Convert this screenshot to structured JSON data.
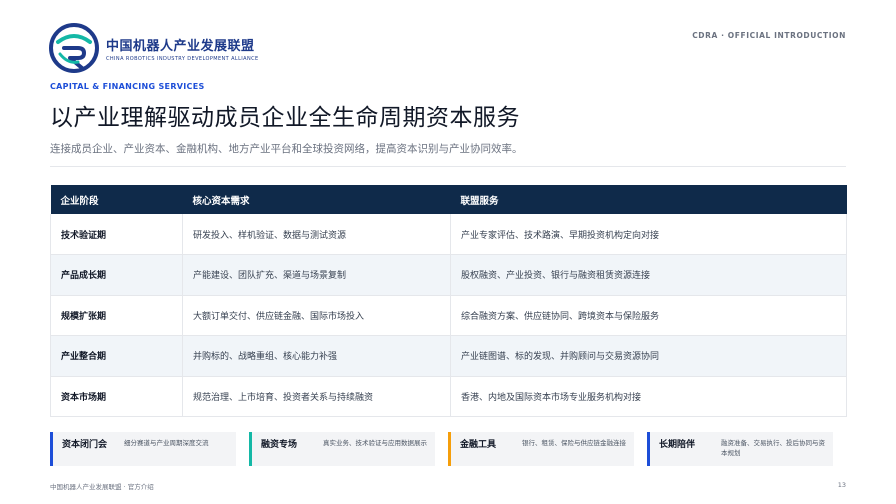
{
  "logo": {
    "name_cn": "中国机器人产业发展联盟",
    "name_en": "CHINA ROBOTICS INDUSTRY DEVELOPMENT ALLIANCE",
    "icon": "cr-ring-logo-icon",
    "colors": {
      "blue": "#1e3a8a",
      "teal": "#14b8a6"
    }
  },
  "header": {
    "top_right": "CDRA · OFFICIAL INTRODUCTION"
  },
  "eyebrow": "CAPITAL & FINANCING SERVICES",
  "title": "以产业理解驱动成员企业全生命周期资本服务",
  "subtitle": "连接成员企业、产业资本、金融机构、地方产业平台和全球投资网络，提高资本识别与产业协同效率。",
  "table": {
    "headers": [
      "企业阶段",
      "核心资本需求",
      "联盟服务"
    ],
    "rows": [
      {
        "stage": "技术验证期",
        "need": "研发投入、样机验证、数据与测试资源",
        "service": "产业专家评估、技术路演、早期投资机构定向对接"
      },
      {
        "stage": "产品成长期",
        "need": "产能建设、团队扩充、渠道与场景复制",
        "service": "股权融资、产业投资、银行与融资租赁资源连接"
      },
      {
        "stage": "规模扩张期",
        "need": "大额订单交付、供应链金融、国际市场投入",
        "service": "综合融资方案、供应链协同、跨境资本与保险服务"
      },
      {
        "stage": "产业整合期",
        "need": "并购标的、战略重组、核心能力补强",
        "service": "产业链图谱、标的发现、并购顾问与交易资源协同"
      },
      {
        "stage": "资本市场期",
        "need": "规范治理、上市培育、投资者关系与持续融资",
        "service": "香港、内地及国际资本市场专业服务机构对接"
      }
    ],
    "header_color": "#0f2a4a"
  },
  "cards": [
    {
      "title": "资本闭门会",
      "desc": "细分赛道与产业周期深度交流",
      "accent": "#1d4ed8"
    },
    {
      "title": "融资专场",
      "desc": "真实业务、技术验证与应用数据展示",
      "accent": "#14b8a6"
    },
    {
      "title": "金融工具",
      "desc": "银行、租赁、保险与供应链金融连接",
      "accent": "#f59e0b"
    },
    {
      "title": "长期陪伴",
      "desc": "融资准备、交易执行、投后协同与资本规划",
      "accent": "#1d4ed8"
    }
  ],
  "footer": {
    "left": "中国机器人产业发展联盟 · 官方介绍",
    "page": "13"
  }
}
